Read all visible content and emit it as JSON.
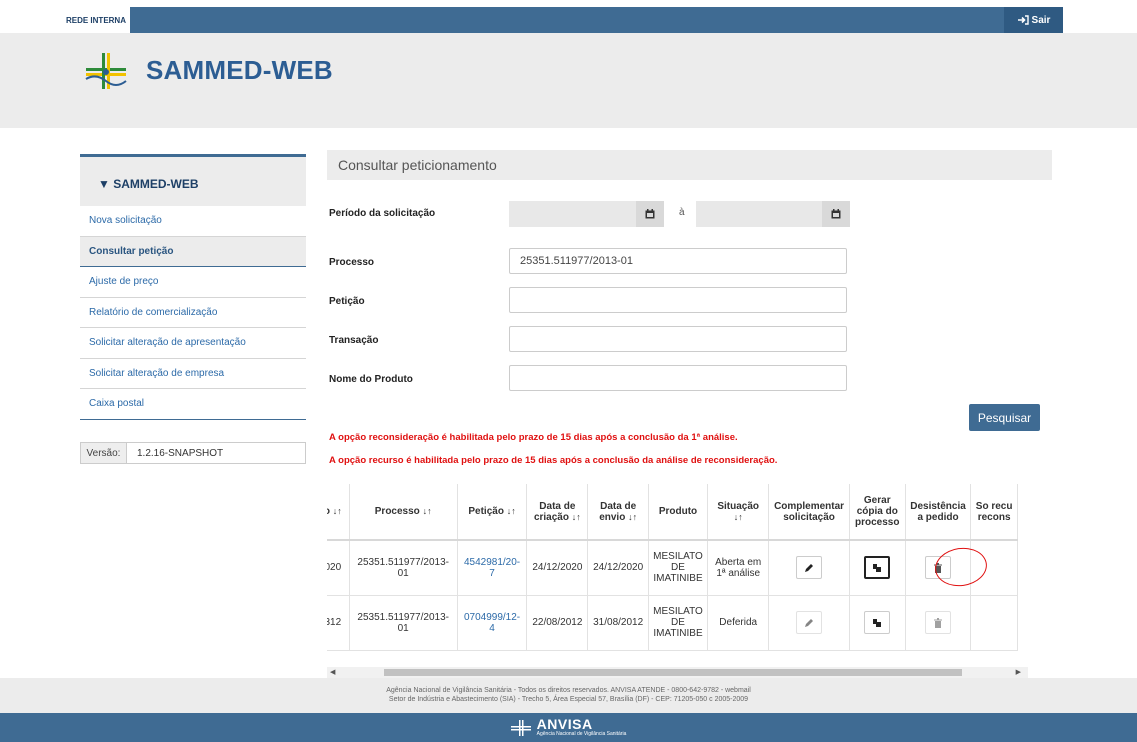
{
  "topbar": {
    "tab_label": "REDE INTERNA",
    "logout_label": "Sair"
  },
  "app": {
    "title": "SAMMED-WEB"
  },
  "sidebar": {
    "heading": "SAMMED-WEB",
    "items": [
      {
        "label": "Nova solicitação",
        "active": false
      },
      {
        "label": "Consultar petição",
        "active": true
      },
      {
        "label": "Ajuste de preço",
        "active": false
      },
      {
        "label": "Relatório de comercialização",
        "active": false
      },
      {
        "label": "Solicitar alteração de apresentação",
        "active": false
      },
      {
        "label": "Solicitar alteração de empresa",
        "active": false
      },
      {
        "label": "Caixa postal",
        "active": false
      }
    ],
    "version_label": "Versão:",
    "version_value": "1.2.16-SNAPSHOT"
  },
  "main": {
    "section_title": "Consultar peticionamento",
    "form": {
      "period_label": "Período da solicitação",
      "date_separator": "à",
      "process_label": "Processo",
      "process_value": "25351.511977/2013-01",
      "petition_label": "Petição",
      "transaction_label": "Transação",
      "product_label": "Nome do Produto",
      "search_button": "Pesquisar"
    },
    "warnings": [
      "A opção reconsideração é habilitada pelo prazo de 15 dias após a conclusão da 1ª análise.",
      "A opção recurso é habilitada pelo prazo de 15 dias após a conclusão da análise de reconsideração."
    ],
    "table": {
      "headers": {
        "col0": "o",
        "processo": "Processo",
        "peticao": "Petição",
        "data_criacao": "Data de criação",
        "data_envio": "Data de envio",
        "produto": "Produto",
        "situacao": "Situação",
        "complementar": "Complementar solicitação",
        "gerar_copia": "Gerar cópia do processo",
        "desistencia": "Desistência a pedido",
        "recurso": "So recu recons"
      },
      "sort_icon": "↓↑",
      "rows": [
        {
          "col0": "020",
          "processo": "25351.511977/2013-01",
          "peticao": "4542981/20-7",
          "data_criacao": "24/12/2020",
          "data_envio": "24/12/2020",
          "produto": "MESILATO DE IMATINIBE",
          "situacao": "Aberta em 1ª análise",
          "enabled": true
        },
        {
          "col0": "312",
          "processo": "25351.511977/2013-01",
          "peticao": "0704999/12-4",
          "data_criacao": "22/08/2012",
          "data_envio": "31/08/2012",
          "produto": "MESILATO DE IMATINIBE",
          "situacao": "Deferida",
          "enabled": false
        }
      ]
    }
  },
  "footer": {
    "line1": "Agência Nacional de Vigilância Sanitária - Todos os direitos reservados. ANVISA ATENDE - 0800-642-9782 - webmail",
    "line2": "Setor de Indústria e Abastecimento (SIA) - Trecho 5, Área Especial 57, Brasília (DF) - CEP: 71205-050 c 2005-2009",
    "brand": "ANVISA",
    "brand_sub": "Agência Nacional de Vigilância Sanitária"
  },
  "colors": {
    "primary": "#3f6b93",
    "warning": "#e01010",
    "link": "#2c6aa8"
  }
}
